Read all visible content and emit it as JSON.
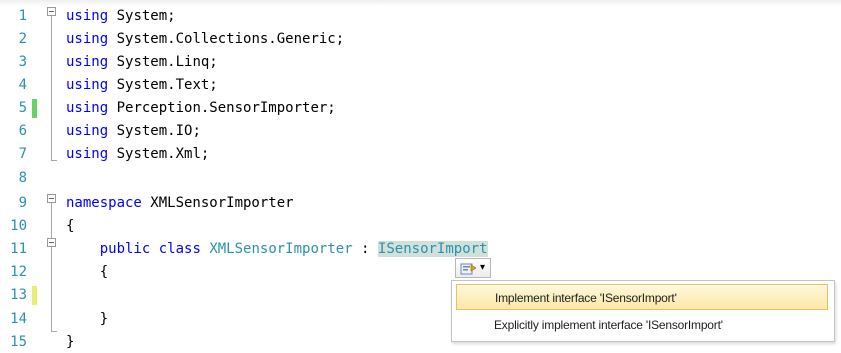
{
  "editor": {
    "lines": [
      {
        "n": "1",
        "tokens": [
          {
            "t": "using",
            "c": "kw"
          },
          {
            "t": " System;",
            "c": ""
          }
        ]
      },
      {
        "n": "2",
        "tokens": [
          {
            "t": "using",
            "c": "kw"
          },
          {
            "t": " System.Collections.Generic;",
            "c": ""
          }
        ]
      },
      {
        "n": "3",
        "tokens": [
          {
            "t": "using",
            "c": "kw"
          },
          {
            "t": " System.Linq;",
            "c": ""
          }
        ]
      },
      {
        "n": "4",
        "tokens": [
          {
            "t": "using",
            "c": "kw"
          },
          {
            "t": " System.Text;",
            "c": ""
          }
        ]
      },
      {
        "n": "5",
        "change": "saved",
        "tokens": [
          {
            "t": "using",
            "c": "kw"
          },
          {
            "t": " Perception.SensorImporter;",
            "c": ""
          }
        ]
      },
      {
        "n": "6",
        "tokens": [
          {
            "t": "using",
            "c": "kw"
          },
          {
            "t": " System.IO;",
            "c": ""
          }
        ]
      },
      {
        "n": "7",
        "tokens": [
          {
            "t": "using",
            "c": "kw"
          },
          {
            "t": " System.Xml;",
            "c": ""
          }
        ]
      },
      {
        "n": "8",
        "tokens": []
      },
      {
        "n": "9",
        "tokens": [
          {
            "t": "namespace",
            "c": "kw"
          },
          {
            "t": " XMLSensorImporter",
            "c": ""
          }
        ]
      },
      {
        "n": "10",
        "tokens": [
          {
            "t": "{",
            "c": ""
          }
        ]
      },
      {
        "n": "11",
        "tokens": [
          {
            "t": "    public",
            "c": "kw"
          },
          {
            "t": " ",
            "c": ""
          },
          {
            "t": "class",
            "c": "kw"
          },
          {
            "t": " ",
            "c": ""
          },
          {
            "t": "XMLSensorImporter",
            "c": "tp"
          },
          {
            "t": " : ",
            "c": ""
          },
          {
            "t": "ISensorImport",
            "c": "tp hl"
          }
        ]
      },
      {
        "n": "12",
        "tokens": [
          {
            "t": "    {",
            "c": ""
          }
        ]
      },
      {
        "n": "13",
        "change": "unsaved",
        "tokens": []
      },
      {
        "n": "14",
        "tokens": [
          {
            "t": "    }",
            "c": ""
          }
        ]
      },
      {
        "n": "15",
        "tokens": [
          {
            "t": "}",
            "c": ""
          }
        ]
      }
    ]
  },
  "smart_tag": {
    "icon": "smart-tag-icon",
    "arrow": "▾"
  },
  "popup": {
    "items": [
      {
        "label": "Implement interface 'ISensorImport'",
        "selected": true
      },
      {
        "label": "Explicitly implement interface 'ISensorImport'",
        "selected": false
      }
    ]
  }
}
